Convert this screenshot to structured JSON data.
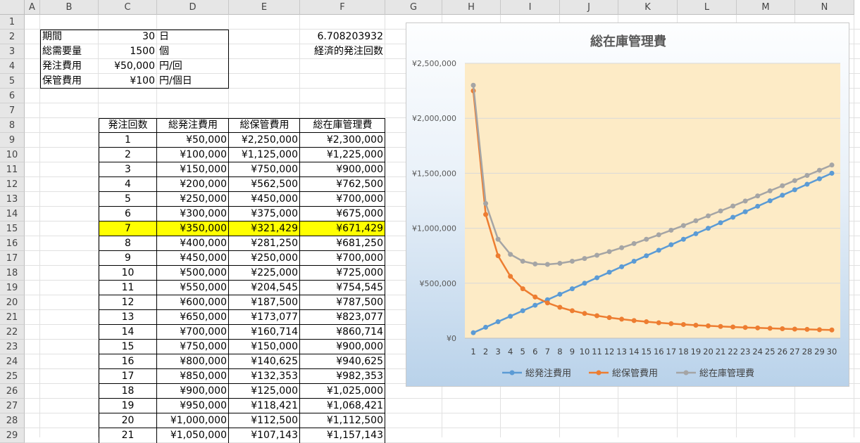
{
  "columns": [
    "A",
    "B",
    "C",
    "D",
    "E",
    "F",
    "G",
    "H",
    "I",
    "J",
    "K",
    "L",
    "M",
    "N"
  ],
  "rows": [
    "1",
    "2",
    "3",
    "4",
    "5",
    "6",
    "7",
    "8",
    "9",
    "10",
    "11",
    "12",
    "13",
    "14",
    "15",
    "16",
    "17",
    "18",
    "19",
    "20",
    "21",
    "22",
    "23",
    "24",
    "25",
    "26",
    "27",
    "28",
    "29"
  ],
  "params": [
    {
      "label": "期間",
      "value": "30",
      "unit": "日"
    },
    {
      "label": "総需要量",
      "value": "1500",
      "unit": "個"
    },
    {
      "label": "発注費用",
      "value": "¥50,000",
      "unit": "円/回"
    },
    {
      "label": "保管費用",
      "value": "¥100",
      "unit": "円/個日"
    }
  ],
  "eoq": {
    "value": "6.708203932",
    "label": "経済的発注回数"
  },
  "table": {
    "headers": [
      "発注回数",
      "総発注費用",
      "総保管費用",
      "総在庫管理費"
    ],
    "highlight_row": 6,
    "rows": [
      [
        "1",
        "¥50,000",
        "¥2,250,000",
        "¥2,300,000"
      ],
      [
        "2",
        "¥100,000",
        "¥1,125,000",
        "¥1,225,000"
      ],
      [
        "3",
        "¥150,000",
        "¥750,000",
        "¥900,000"
      ],
      [
        "4",
        "¥200,000",
        "¥562,500",
        "¥762,500"
      ],
      [
        "5",
        "¥250,000",
        "¥450,000",
        "¥700,000"
      ],
      [
        "6",
        "¥300,000",
        "¥375,000",
        "¥675,000"
      ],
      [
        "7",
        "¥350,000",
        "¥321,429",
        "¥671,429"
      ],
      [
        "8",
        "¥400,000",
        "¥281,250",
        "¥681,250"
      ],
      [
        "9",
        "¥450,000",
        "¥250,000",
        "¥700,000"
      ],
      [
        "10",
        "¥500,000",
        "¥225,000",
        "¥725,000"
      ],
      [
        "11",
        "¥550,000",
        "¥204,545",
        "¥754,545"
      ],
      [
        "12",
        "¥600,000",
        "¥187,500",
        "¥787,500"
      ],
      [
        "13",
        "¥650,000",
        "¥173,077",
        "¥823,077"
      ],
      [
        "14",
        "¥700,000",
        "¥160,714",
        "¥860,714"
      ],
      [
        "15",
        "¥750,000",
        "¥150,000",
        "¥900,000"
      ],
      [
        "16",
        "¥800,000",
        "¥140,625",
        "¥940,625"
      ],
      [
        "17",
        "¥850,000",
        "¥132,353",
        "¥982,353"
      ],
      [
        "18",
        "¥900,000",
        "¥125,000",
        "¥1,025,000"
      ],
      [
        "19",
        "¥950,000",
        "¥118,421",
        "¥1,068,421"
      ],
      [
        "20",
        "¥1,000,000",
        "¥112,500",
        "¥1,112,500"
      ],
      [
        "21",
        "¥1,050,000",
        "¥107,143",
        "¥1,157,143"
      ]
    ]
  },
  "chart_data": {
    "type": "line",
    "title": "総在庫管理費",
    "x": [
      1,
      2,
      3,
      4,
      5,
      6,
      7,
      8,
      9,
      10,
      11,
      12,
      13,
      14,
      15,
      16,
      17,
      18,
      19,
      20,
      21,
      22,
      23,
      24,
      25,
      26,
      27,
      28,
      29,
      30
    ],
    "y_ticks": [
      "¥0",
      "¥500,000",
      "¥1,000,000",
      "¥1,500,000",
      "¥2,000,000",
      "¥2,500,000"
    ],
    "ylim": [
      0,
      2500000
    ],
    "legend_position": "bottom",
    "series": [
      {
        "name": "総発注費用",
        "color": "#5b9bd5",
        "values": [
          50000,
          100000,
          150000,
          200000,
          250000,
          300000,
          350000,
          400000,
          450000,
          500000,
          550000,
          600000,
          650000,
          700000,
          750000,
          800000,
          850000,
          900000,
          950000,
          1000000,
          1050000,
          1100000,
          1150000,
          1200000,
          1250000,
          1300000,
          1350000,
          1400000,
          1450000,
          1500000
        ]
      },
      {
        "name": "総保管費用",
        "color": "#ed7d31",
        "values": [
          2250000,
          1125000,
          750000,
          562500,
          450000,
          375000,
          321429,
          281250,
          250000,
          225000,
          204545,
          187500,
          173077,
          160714,
          150000,
          140625,
          132353,
          125000,
          118421,
          112500,
          107143,
          102273,
          97826,
          93750,
          90000,
          86538,
          83333,
          80357,
          77586,
          75000
        ]
      },
      {
        "name": "総在庫管理費",
        "color": "#a5a5a5",
        "values": [
          2300000,
          1225000,
          900000,
          762500,
          700000,
          675000,
          671429,
          681250,
          700000,
          725000,
          754545,
          787500,
          823077,
          860714,
          900000,
          940625,
          982353,
          1025000,
          1068421,
          1112500,
          1157143,
          1202273,
          1247826,
          1293750,
          1340000,
          1386538,
          1433333,
          1480357,
          1527586,
          1575000
        ]
      }
    ]
  }
}
